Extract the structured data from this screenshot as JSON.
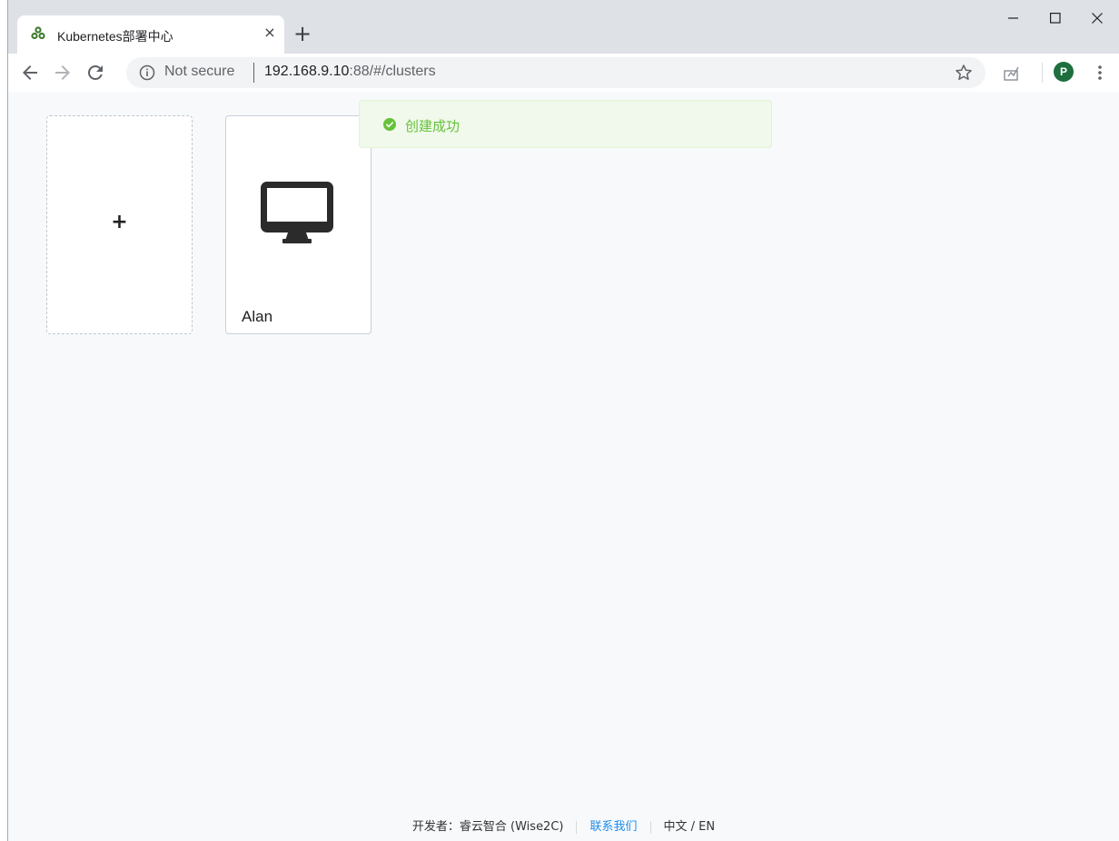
{
  "browser": {
    "tab_title": "Kubernetes部署中心",
    "tab_close": "×",
    "new_tab": "+",
    "omnibox": {
      "security_label": "Not secure",
      "url_host": "192.168.9.10",
      "url_path": ":88/#/clusters"
    },
    "avatar_letter": "P"
  },
  "page": {
    "add_card_label": "+",
    "clusters": [
      {
        "name": "Alan"
      }
    ],
    "toast": {
      "message": "创建成功",
      "type": "success"
    },
    "footer": {
      "developer": "开发者：睿云智合 (Wise2C)",
      "contact": "联系我们",
      "language": "中文 / EN"
    }
  },
  "colors": {
    "success": "#67c23a",
    "link": "#1f8ceb",
    "avatar": "#1e6e3e"
  }
}
